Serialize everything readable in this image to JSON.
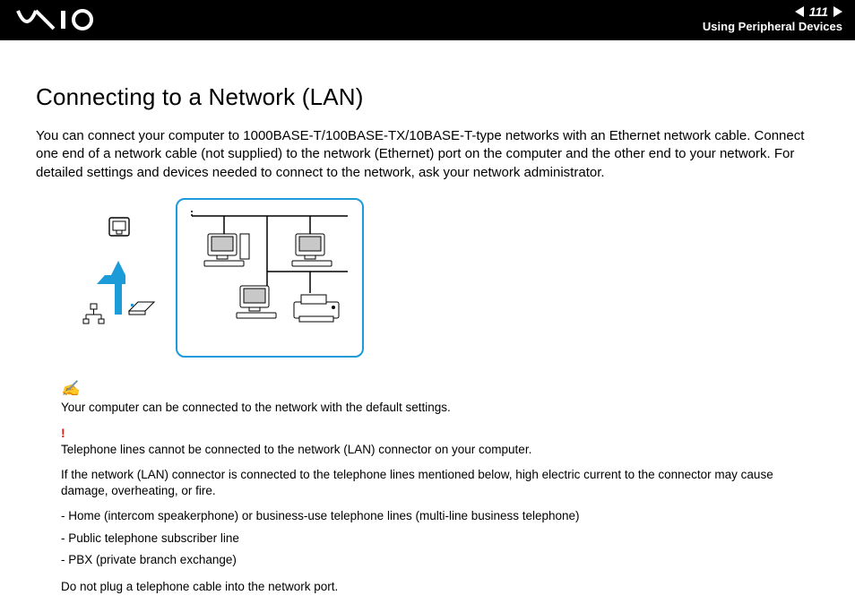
{
  "header": {
    "page_number": "111",
    "section": "Using Peripheral Devices"
  },
  "title": "Connecting to a Network (LAN)",
  "intro": "You can connect your computer to 1000BASE-T/100BASE-TX/10BASE-T-type networks with an Ethernet network cable. Connect one end of a network cable (not supplied) to the network (Ethernet) port on the computer and the other end to your network. For detailed settings and devices needed to connect to the network, ask your network administrator.",
  "note": {
    "text": "Your computer can be connected to the network with the default settings."
  },
  "warning": {
    "line1": "Telephone lines cannot be connected to the network (LAN) connector on your computer.",
    "line2": "If the network (LAN) connector is connected to the telephone lines mentioned below, high electric current to the connector may cause damage, overheating, or fire.",
    "bullets": {
      "b1": "- Home (intercom speakerphone) or business-use telephone lines (multi-line business telephone)",
      "b2": "- Public telephone subscriber line",
      "b3": "- PBX (private branch exchange)"
    },
    "final": "Do not plug a telephone cable into the network port."
  }
}
